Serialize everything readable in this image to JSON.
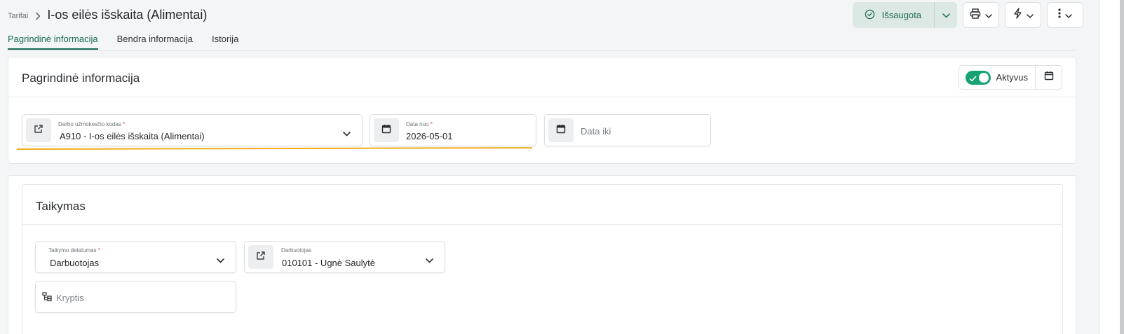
{
  "header": {
    "breadcrumb_root": "Tarifai",
    "title": "I-os eilės išskaita (Alimentai)"
  },
  "toolbar": {
    "save_status": "Išsaugota"
  },
  "tabs": [
    {
      "label": "Pagrindinė informacija",
      "active": true
    },
    {
      "label": "Bendra informacija",
      "active": false
    },
    {
      "label": "Istorija",
      "active": false
    }
  ],
  "main_info": {
    "title": "Pagrindinė informacija",
    "status_label": "Aktyvus",
    "status_active": true,
    "pay_code": {
      "label": "Darbo užmokesčio kodas",
      "required_mark": "*",
      "value": "A910 - I-os eilės išskaita (Alimentai)"
    },
    "date_from": {
      "label": "Data nuo",
      "required_mark": "*",
      "value": "2026-05-01"
    },
    "date_to": {
      "placeholder": "Data iki"
    }
  },
  "scope": {
    "title": "Taikymas",
    "detail_level": {
      "label": "Taikymo detalumas",
      "required_mark": "*",
      "value": "Darbuotojas"
    },
    "employee": {
      "label": "Darbuotojas",
      "value": "010101 - Ugnė Saulytė"
    },
    "direction": {
      "placeholder": "Kryptis"
    }
  },
  "colors": {
    "accent": "#1a6b56",
    "toggle_on": "#17a274",
    "highlight": "#f0ad1c",
    "save_bg": "#dbe8e4"
  }
}
